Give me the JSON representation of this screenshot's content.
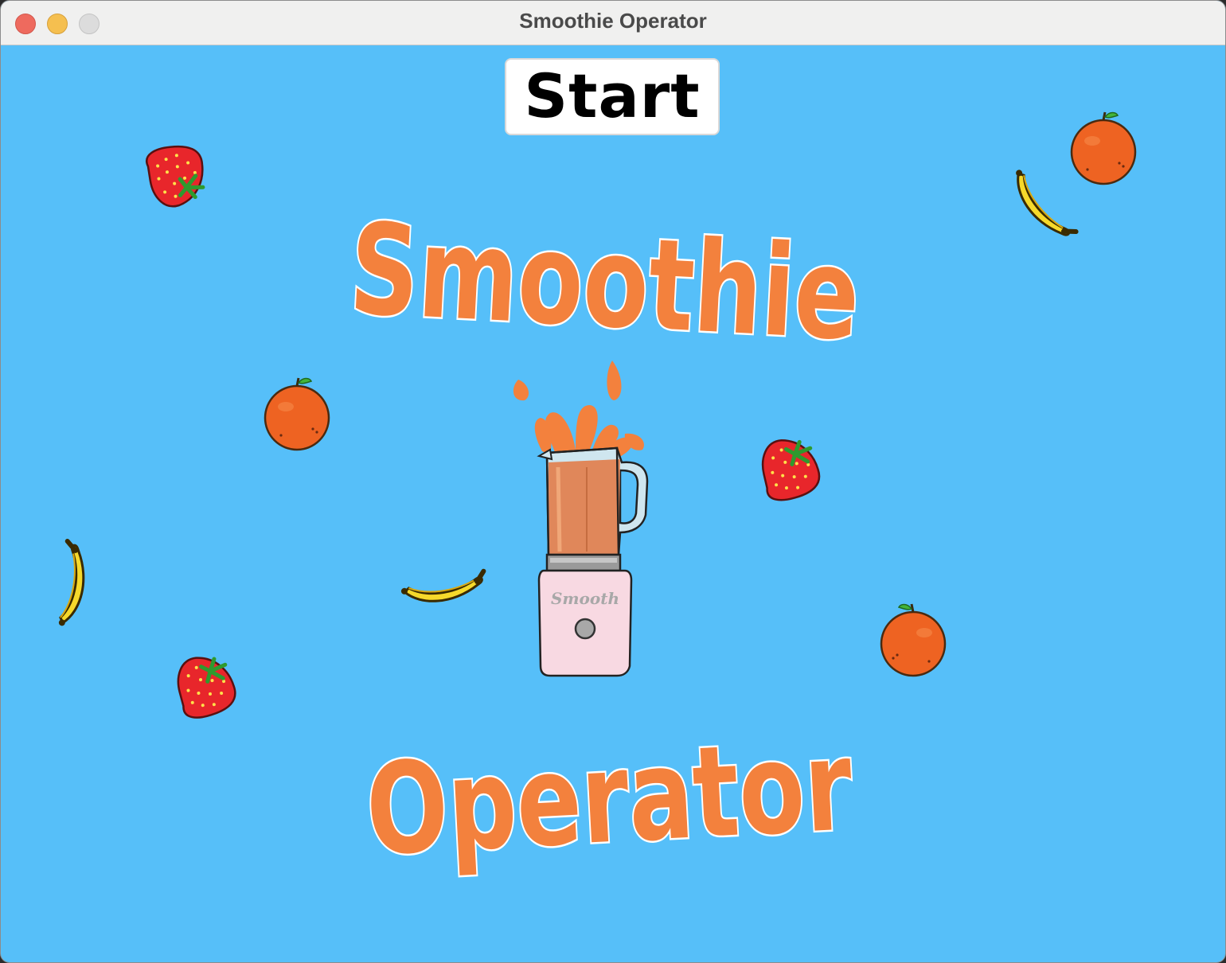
{
  "window": {
    "title": "Smoothie Operator"
  },
  "menu": {
    "start_label": "Start",
    "logo_top": "Smoothie",
    "logo_bottom": "Operator",
    "blender_brand": "Smooth"
  },
  "colors": {
    "background": "#56bff9",
    "logo_orange": "#f3813d",
    "juice": "#e0875a",
    "blender_base": "#f8d9e2"
  },
  "sprites": [
    "strawberry-icon",
    "orange-icon",
    "banana-icon",
    "blender-icon"
  ]
}
